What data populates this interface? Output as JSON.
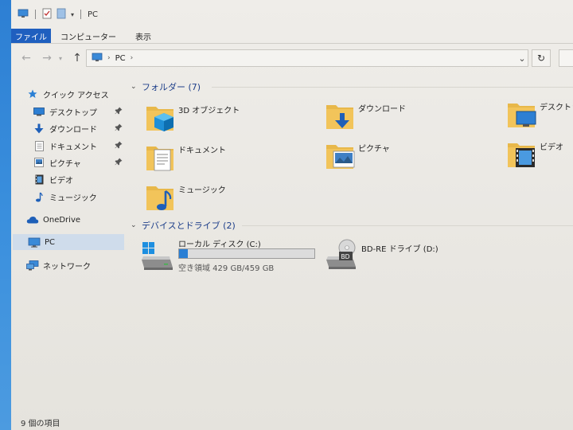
{
  "titlebar": {
    "title": "PC"
  },
  "ribbon": {
    "tabs": [
      {
        "label": "ファイル"
      },
      {
        "label": "コンピューター"
      },
      {
        "label": "表示"
      }
    ]
  },
  "address": {
    "location": "PC"
  },
  "nav_pane": {
    "items": [
      {
        "label": "クイック アクセス",
        "icon": "star-icon"
      },
      {
        "label": "デスクトップ",
        "icon": "desktop-icon",
        "pinned": true
      },
      {
        "label": "ダウンロード",
        "icon": "download-arrow-icon",
        "pinned": true
      },
      {
        "label": "ドキュメント",
        "icon": "document-icon",
        "pinned": true
      },
      {
        "label": "ピクチャ",
        "icon": "picture-icon",
        "pinned": true
      },
      {
        "label": "ビデオ",
        "icon": "video-icon"
      },
      {
        "label": "ミュージック",
        "icon": "music-icon"
      },
      {
        "label": "OneDrive",
        "icon": "cloud-icon"
      },
      {
        "label": "PC",
        "icon": "computer-icon",
        "selected": true
      },
      {
        "label": "ネットワーク",
        "icon": "network-icon"
      }
    ]
  },
  "folders_group": {
    "header": "フォルダー (7)",
    "items": [
      {
        "label": "3D オブジェクト",
        "icon": "3d-objects-folder-icon"
      },
      {
        "label": "ダウンロード",
        "icon": "downloads-folder-icon"
      },
      {
        "label": "デスクトップ",
        "icon": "desktop-folder-icon"
      },
      {
        "label": "ドキュメント",
        "icon": "documents-folder-icon"
      },
      {
        "label": "ピクチャ",
        "icon": "pictures-folder-icon"
      },
      {
        "label": "ビデオ",
        "icon": "videos-folder-icon"
      },
      {
        "label": "ミュージック",
        "icon": "music-folder-icon"
      }
    ]
  },
  "drives_group": {
    "header": "デバイスとドライブ (2)",
    "drives": [
      {
        "label": "ローカル ディスク (C:)",
        "free_text": "空き領域 429 GB/459 GB",
        "used_fraction": 0.065,
        "icon": "windows-drive-icon"
      },
      {
        "label": "BD-RE ドライブ (D:)",
        "icon": "bd-drive-icon"
      }
    ]
  },
  "statusbar": {
    "text": "9 個の項目"
  },
  "colors": {
    "accent": "#1f5fbf",
    "header_text": "#1e3f8a",
    "folder": "#e8b84a",
    "usage_bar": "#2a7fd4",
    "desktop": "#2d7fd3"
  }
}
